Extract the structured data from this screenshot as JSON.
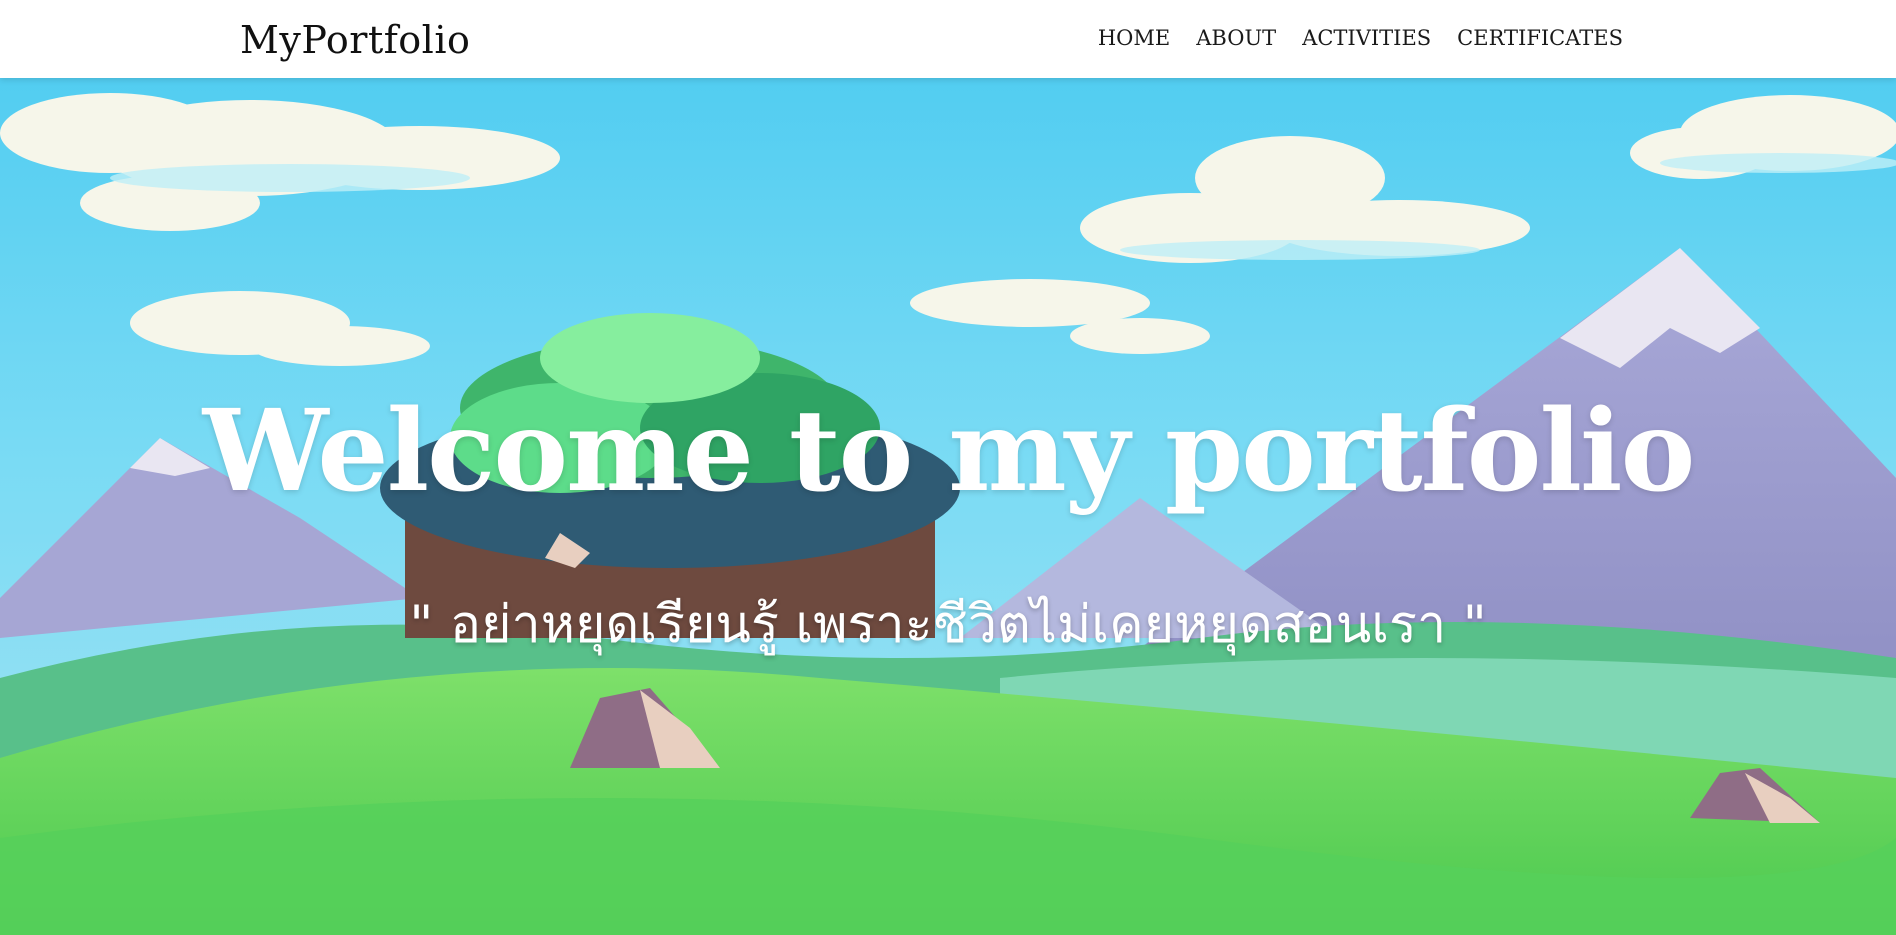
{
  "navbar": {
    "brand": "MyPortfolio",
    "links": [
      {
        "label": "HOME"
      },
      {
        "label": "ABOUT"
      },
      {
        "label": "ACTIVITIES"
      },
      {
        "label": "CERTIFICATES"
      }
    ]
  },
  "hero": {
    "title": "Welcome to my portfolio",
    "quote": "\" อย่าหยุดเรียนรู้ เพราะชีวิตไม่เคยหยุดสอนเรา \""
  },
  "colors": {
    "sky": "#57d0f2",
    "grass": "#5fd65a",
    "mountain": "#9d9fcf",
    "snow": "#e9e6f2",
    "tree": "#3fb56b",
    "cloud": "#f6f6ea"
  }
}
